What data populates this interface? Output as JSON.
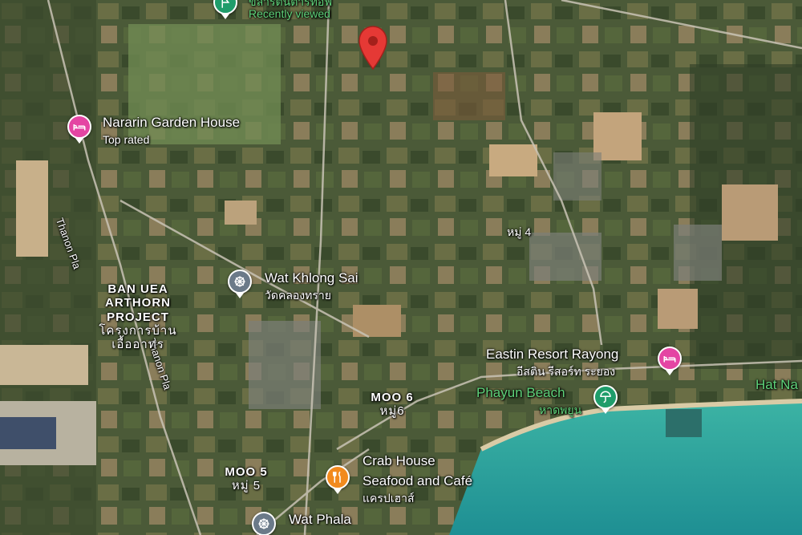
{
  "places": {
    "golf": {
      "name": "ขลาร์ตนตาร์ท์อฟ",
      "tag": "Recently viewed"
    },
    "nararin": {
      "name": "Nararin Garden House",
      "tag": "Top rated"
    },
    "wat_khlong_sai": {
      "name": "Wat Khlong Sai",
      "thai": "วัดคลองทราย"
    },
    "eastin": {
      "name": "Eastin Resort Rayong",
      "thai": "อีสติน รีสอร์ท ระยอง"
    },
    "phayun": {
      "name": "Phayun Beach",
      "thai": "หาดพยูน"
    },
    "crab": {
      "line1": "Crab House",
      "line2": "Seafood and Café",
      "thai": "แครปเฮาส์"
    },
    "wat_phala": {
      "name": "Wat Phala"
    },
    "hat_na": {
      "name": "Hat Na"
    }
  },
  "areas": {
    "ban_uea": {
      "line1": "BAN UEA",
      "line2": "ARTHORN",
      "line3": "PROJECT",
      "thai1": "โครงการบ้าน",
      "thai2": "เอื้ออาทร"
    },
    "moo6": {
      "name": "MOO 6",
      "thai": "หมู่6"
    },
    "moo5": {
      "name": "MOO 5",
      "thai": "หมู่ 5"
    },
    "moo4": {
      "thai": "หมู่ 4"
    }
  },
  "roads": {
    "thanon_pla_1": "Thanon Pla",
    "thanon_pla_2": "Thanon Pla"
  },
  "icons": {
    "hotel": "bed-icon",
    "temple": "dharma-wheel-icon",
    "food": "fork-knife-icon",
    "beach": "umbrella-icon",
    "pin": "map-pin-icon"
  },
  "colors": {
    "hotel": "#e445a3",
    "temple": "#6b7a89",
    "food": "#f28a1e",
    "beach": "#1f9d6b",
    "pin": "#e53935",
    "sea": "#2aa39b"
  }
}
